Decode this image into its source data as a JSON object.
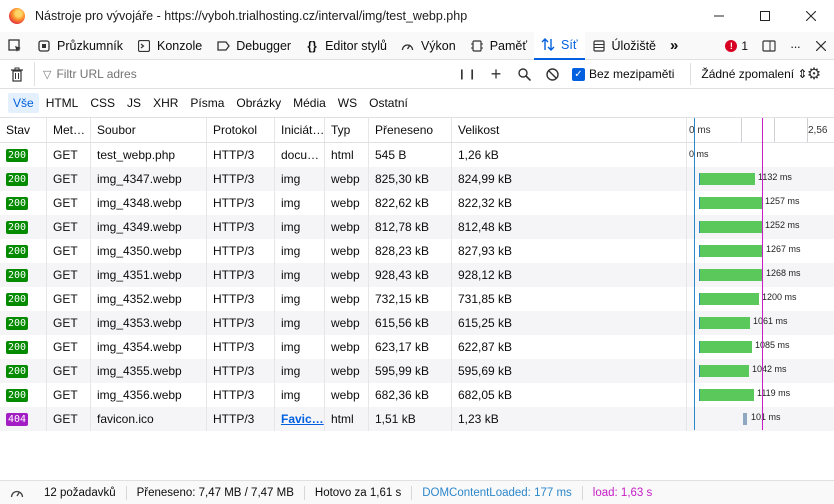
{
  "window": {
    "title": "Nástroje pro vývojáře - https://vyboh.trialhosting.cz/interval/img/test_webp.php"
  },
  "toolbar": {
    "tabs": [
      {
        "label": "Průzkumník",
        "icon": "inspector-icon"
      },
      {
        "label": "Konzole",
        "icon": "console-icon"
      },
      {
        "label": "Debugger",
        "icon": "debugger-icon"
      },
      {
        "label": "Editor stylů",
        "icon": "style-editor-icon"
      },
      {
        "label": "Výkon",
        "icon": "performance-icon"
      },
      {
        "label": "Paměť",
        "icon": "memory-icon"
      },
      {
        "label": "Síť",
        "icon": "network-icon",
        "active": true
      },
      {
        "label": "Úložiště",
        "icon": "storage-icon"
      }
    ],
    "error_count": "1"
  },
  "filter": {
    "placeholder": "Filtr URL adres",
    "disable_cache_label": "Bez mezipaměti",
    "throttle_label": "Žádné zpomalení ⇕"
  },
  "types": [
    "Vše",
    "HTML",
    "CSS",
    "JS",
    "XHR",
    "Písma",
    "Obrázky",
    "Média",
    "WS",
    "Ostatní"
  ],
  "columns": {
    "stav": "Stav",
    "metoda": "Met…",
    "soubor": "Soubor",
    "protokol": "Protokol",
    "iniciator": "Iniciát…",
    "typ": "Typ",
    "preneseno": "Přeneseno",
    "velikost": "Velikost"
  },
  "timeline": {
    "start_label": "0 ms",
    "end_label": "2,56"
  },
  "requests": [
    {
      "status": "200",
      "method": "GET",
      "file": "test_webp.php",
      "protocol": "HTTP/3",
      "initiator": "docu…",
      "type": "html",
      "transferred": "545 B",
      "size": "1,26 kB",
      "time_label": "0 ms"
    },
    {
      "status": "200",
      "method": "GET",
      "file": "img_4347.webp",
      "protocol": "HTTP/3",
      "initiator": "img",
      "type": "webp",
      "transferred": "825,30 kB",
      "size": "824,99 kB",
      "time_label": "1132 ms"
    },
    {
      "status": "200",
      "method": "GET",
      "file": "img_4348.webp",
      "protocol": "HTTP/3",
      "initiator": "img",
      "type": "webp",
      "transferred": "822,62 kB",
      "size": "822,32 kB",
      "time_label": "1257 ms"
    },
    {
      "status": "200",
      "method": "GET",
      "file": "img_4349.webp",
      "protocol": "HTTP/3",
      "initiator": "img",
      "type": "webp",
      "transferred": "812,78 kB",
      "size": "812,48 kB",
      "time_label": "1252 ms"
    },
    {
      "status": "200",
      "method": "GET",
      "file": "img_4350.webp",
      "protocol": "HTTP/3",
      "initiator": "img",
      "type": "webp",
      "transferred": "828,23 kB",
      "size": "827,93 kB",
      "time_label": "1267 ms"
    },
    {
      "status": "200",
      "method": "GET",
      "file": "img_4351.webp",
      "protocol": "HTTP/3",
      "initiator": "img",
      "type": "webp",
      "transferred": "928,43 kB",
      "size": "928,12 kB",
      "time_label": "1268 ms"
    },
    {
      "status": "200",
      "method": "GET",
      "file": "img_4352.webp",
      "protocol": "HTTP/3",
      "initiator": "img",
      "type": "webp",
      "transferred": "732,15 kB",
      "size": "731,85 kB",
      "time_label": "1200 ms"
    },
    {
      "status": "200",
      "method": "GET",
      "file": "img_4353.webp",
      "protocol": "HTTP/3",
      "initiator": "img",
      "type": "webp",
      "transferred": "615,56 kB",
      "size": "615,25 kB",
      "time_label": "1061 ms"
    },
    {
      "status": "200",
      "method": "GET",
      "file": "img_4354.webp",
      "protocol": "HTTP/3",
      "initiator": "img",
      "type": "webp",
      "transferred": "623,17 kB",
      "size": "622,87 kB",
      "time_label": "1085 ms"
    },
    {
      "status": "200",
      "method": "GET",
      "file": "img_4355.webp",
      "protocol": "HTTP/3",
      "initiator": "img",
      "type": "webp",
      "transferred": "595,99 kB",
      "size": "595,69 kB",
      "time_label": "1042 ms"
    },
    {
      "status": "200",
      "method": "GET",
      "file": "img_4356.webp",
      "protocol": "HTTP/3",
      "initiator": "img",
      "type": "webp",
      "transferred": "682,36 kB",
      "size": "682,05 kB",
      "time_label": "1119 ms"
    },
    {
      "status": "404",
      "method": "GET",
      "file": "favicon.ico",
      "protocol": "HTTP/3",
      "initiator": "Favic…",
      "type": "html",
      "transferred": "1,51 kB",
      "size": "1,23 kB",
      "time_label": "101 ms"
    }
  ],
  "statusbar": {
    "requests": "12 požadavků",
    "transferred": "Přeneseno: 7,47 MB / 7,47 MB",
    "finished": "Hotovo za 1,61 s",
    "dcl": "DOMContentLoaded: 177 ms",
    "load": "load: 1,63 s"
  },
  "colors": {
    "accent": "#0060df",
    "status_ok": "#058b00",
    "status_404": "#a31dc4",
    "bar": "#5ac85a",
    "dcl_line": "#2d87c9",
    "load_line": "#c51ec5"
  }
}
